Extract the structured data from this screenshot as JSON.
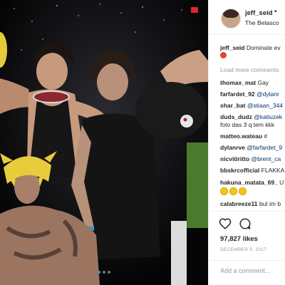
{
  "post": {
    "username": "jeff_seid",
    "more_dot": "•",
    "location": "The Belasco",
    "caption_user": "jeff_seid",
    "caption_text": "Dominate ev",
    "load_more": "Load more comments",
    "comments": [
      {
        "user": "thomax_mat",
        "text": "Gay"
      },
      {
        "user": "farfardet_92",
        "mention": "@dylanr"
      },
      {
        "user": "shar_bat",
        "mention": "@stiaan_344"
      },
      {
        "user": "duds_dudz",
        "mention": "@katiuzek",
        "cont": "foto das 3 q tem kkk"
      },
      {
        "user": "matteo.wateau",
        "text": "#"
      },
      {
        "user": "dylanrve",
        "mention": "@farfardet_9"
      },
      {
        "user": "nicvitiritto",
        "mention": "@brent_ca"
      },
      {
        "user": "bbskrcofficial",
        "text": "FLAKKA"
      },
      {
        "user": "hakuna_matata_69_",
        "text": "U"
      },
      {
        "user": "calabreeze11",
        "text": "but im b"
      }
    ],
    "likes": "97,827 likes",
    "date": "DECEMBER 3, 2017",
    "add_comment_placeholder": "Add a comment..."
  },
  "photo": {
    "badge_color": "#e0262a",
    "carousel_active_index": 0,
    "carousel_count": 3
  },
  "icons": [
    "heart-icon",
    "comment-icon",
    "more-icon",
    "devil-emoji-icon",
    "tear-emoji-icon"
  ],
  "colors": {
    "link": "#003569",
    "muted": "#999999",
    "text": "#262626",
    "active_dot": "#3897f0"
  }
}
